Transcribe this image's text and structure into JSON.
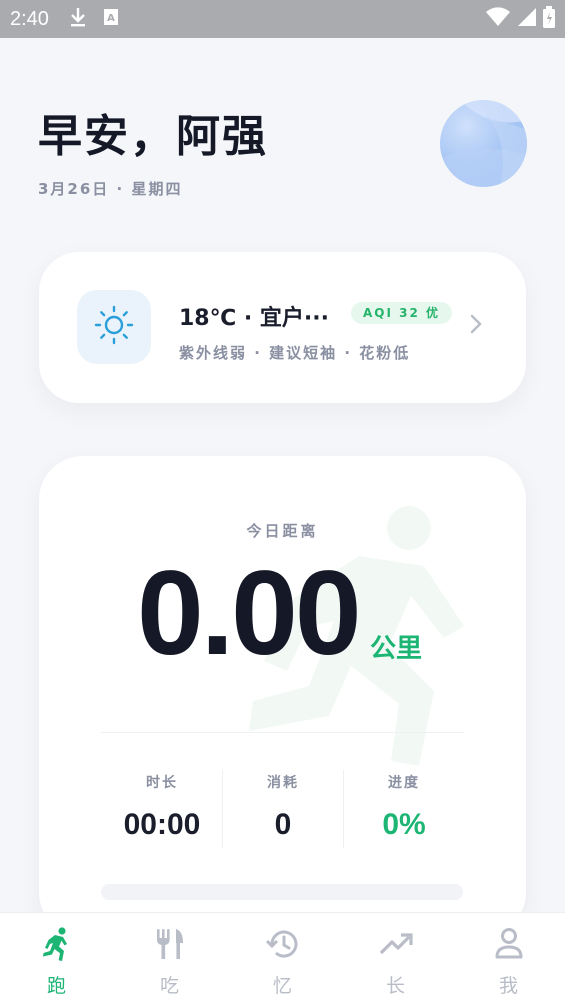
{
  "status_bar": {
    "time": "2:40",
    "icons_left": [
      "download-icon",
      "text-icon"
    ],
    "icons_right": [
      "wifi-icon",
      "signal-icon",
      "battery-icon"
    ]
  },
  "header": {
    "greeting": "早安，阿强",
    "date": "3月26日 · 星期四"
  },
  "weather": {
    "icon": "sun-icon",
    "summary": "18℃ · 宜户···",
    "aqi": "AQI 32 优",
    "details": "紫外线弱 · 建议短袖 · 花粉低"
  },
  "today": {
    "label": "今日距离",
    "distance": "0.00",
    "unit": "公里",
    "progress": 0,
    "stats": [
      {
        "label": "时长",
        "value": "00:00"
      },
      {
        "label": "消耗",
        "value": "0"
      },
      {
        "label": "进度",
        "value": "0%"
      }
    ]
  },
  "nav": {
    "items": [
      {
        "label": "跑",
        "icon": "runner-icon"
      },
      {
        "label": "吃",
        "icon": "fork-knife-icon"
      },
      {
        "label": "忆",
        "icon": "history-icon"
      },
      {
        "label": "长",
        "icon": "trending-up-icon"
      },
      {
        "label": "我",
        "icon": "person-icon"
      }
    ],
    "active": "跑"
  },
  "colors": {
    "accent": "#1db574",
    "text_primary": "#141827",
    "text_secondary": "#8a90a2",
    "weather_icon": "#2b9fd9"
  }
}
